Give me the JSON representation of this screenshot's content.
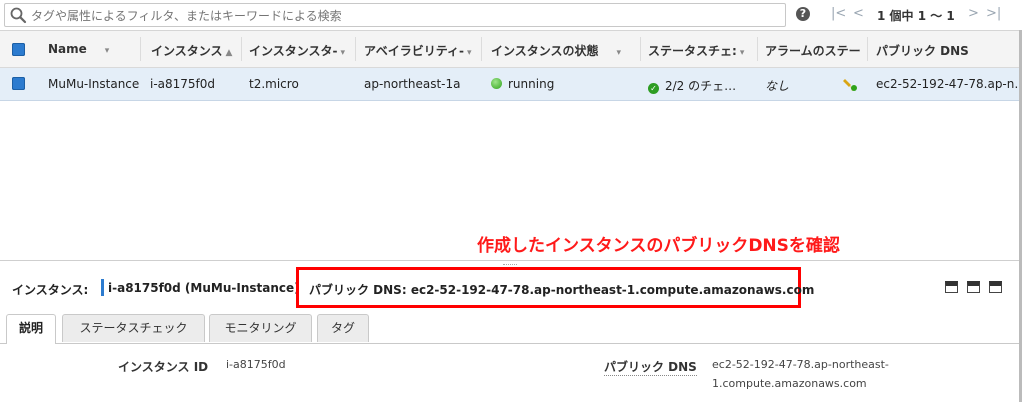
{
  "search": {
    "placeholder": "タグや属性によるフィルタ、またはキーワードによる検索"
  },
  "pagination": {
    "first": "|<",
    "prev": "<",
    "count": "1 個中 1 〜 1",
    "next": ">",
    "last": ">|"
  },
  "table": {
    "columns": [
      "Name",
      "インスタンス",
      "インスタンスタ-",
      "アベイラビリティ-",
      "インスタンスの状態",
      "ステータスチェ:",
      "アラームのステー",
      "パブリック DNS"
    ],
    "rows": [
      {
        "name": "MuMu-Instance",
        "instance_id": "i-a8175f0d",
        "instance_type": "t2.micro",
        "az": "ap-northeast-1a",
        "state": "running",
        "status_check": "2/2 のチェ…",
        "alarm": "なし",
        "public_dns": "ec2-52-192-47-78.ap-n…"
      }
    ]
  },
  "annotation": "作成したインスタンスのパブリックDNSを確認",
  "detail": {
    "label": "インスタンス:",
    "value": "i-a8175f0d (MuMu-Instance)",
    "dns_label": "パブリック DNS:",
    "dns_value": "ec2-52-192-47-78.ap-northeast-1.compute.amazonaws.com",
    "tabs": [
      "説明",
      "ステータスチェック",
      "モニタリング",
      "タグ"
    ],
    "fields": {
      "instance_id_label": "インスタンス ID",
      "instance_id_value": "i-a8175f0d",
      "public_dns_label": "パブリック DNS",
      "public_dns_value_line1": "ec2-52-192-47-78.ap-northeast-",
      "public_dns_value_line2": "1.compute.amazonaws.com"
    }
  },
  "colors": {
    "accent": "#2c7bcf",
    "annotation": "#ff1a1a",
    "running": "#2fa31a"
  }
}
